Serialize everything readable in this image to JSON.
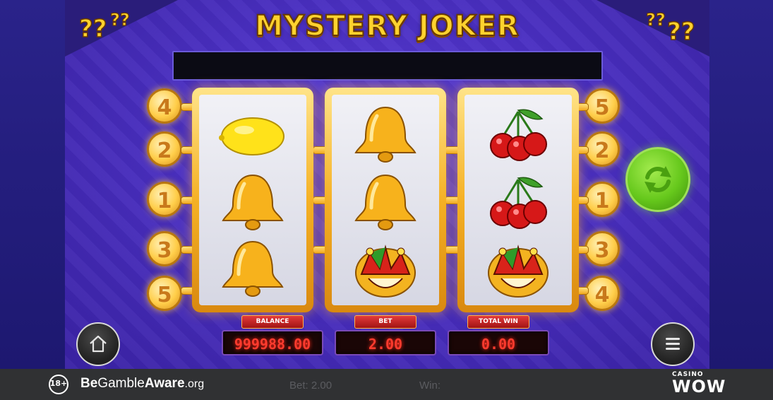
{
  "game": {
    "title": "MYSTERY JOKER",
    "message": "",
    "reels": [
      [
        "lemon",
        "bell",
        "bell"
      ],
      [
        "bell",
        "bell",
        "joker"
      ],
      [
        "cherries",
        "cherries",
        "joker"
      ]
    ],
    "paylines_left": [
      "4",
      "2",
      "1",
      "3",
      "5"
    ],
    "paylines_right": [
      "5",
      "2",
      "1",
      "3",
      "4"
    ],
    "meters": {
      "balance_label": "BALANCE",
      "balance_value": "999988.00",
      "bet_label": "BET",
      "bet_value": "2.00",
      "total_win_label": "TOTAL WIN",
      "total_win_value": "0.00"
    },
    "buttons": {
      "spin_icon": "refresh-icon",
      "home_icon": "home-icon",
      "menu_icon": "menu-icon"
    },
    "colors": {
      "background": "#4a2fc2",
      "gold": "#ffd22e",
      "spin_green": "#66c81c",
      "meter_red": "#ff3b2e"
    }
  },
  "footer": {
    "age_badge": "18+",
    "bga_be": "Be",
    "bga_gamble": "Gamble",
    "bga_aware": "Aware",
    "bga_org": ".org",
    "bet_label": "Bet:",
    "bet_value": "2.00",
    "win_label": "Win:",
    "casino_small": "CASINO",
    "casino_big": "WOW"
  }
}
